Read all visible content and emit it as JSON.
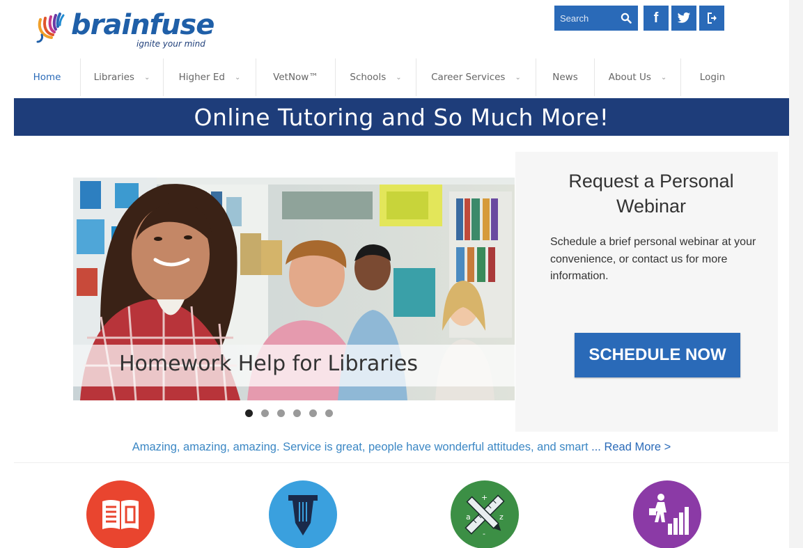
{
  "brand": {
    "name": "brainfuse",
    "tagline": "ignite your mind",
    "color": "#1f5fa8"
  },
  "header": {
    "search": {
      "placeholder": "Search",
      "icon": "search-icon"
    },
    "social": [
      {
        "label": "f",
        "icon": "facebook-icon"
      },
      {
        "label": "",
        "icon": "twitter-icon"
      },
      {
        "label": "",
        "icon": "sign-in-icon"
      }
    ]
  },
  "nav": {
    "items": [
      {
        "label": "Home",
        "active": true
      },
      {
        "label": "Libraries",
        "dropdown": true
      },
      {
        "label": "Higher Ed",
        "dropdown": true
      },
      {
        "label": "VetNow™",
        "dropdown": false
      },
      {
        "label": "Schools",
        "dropdown": true
      },
      {
        "label": "Career Services",
        "dropdown": true
      },
      {
        "label": "News",
        "dropdown": false
      },
      {
        "label": "About Us",
        "dropdown": true
      },
      {
        "label": "Login",
        "dropdown": false
      }
    ]
  },
  "banner": {
    "text": "Online Tutoring and So Much More!",
    "color": "#1e3d7a"
  },
  "slider": {
    "caption": "Homework Help for Libraries",
    "slide_count": 6,
    "active_index": 0
  },
  "webinar": {
    "title": "Request a Personal Webinar",
    "body": "Schedule a brief personal webinar at your convenience, or contact us for more information.",
    "button_label": "SCHEDULE NOW"
  },
  "testimonial": {
    "text": "Amazing, amazing, amazing. Service is great, people have wonderful attitudes, and smart",
    "more_label": "... Read More >"
  },
  "features": [
    {
      "icon": "book-icon",
      "color": "#e9452f"
    },
    {
      "icon": "pen-icon",
      "color": "#3aa0de"
    },
    {
      "icon": "ruler-pencil-icon",
      "color": "#3c8f45"
    },
    {
      "icon": "career-stairs-icon",
      "color": "#8b3aa6"
    }
  ],
  "colors": {
    "accent": "#2a6ab8",
    "link": "#3b87c4"
  }
}
